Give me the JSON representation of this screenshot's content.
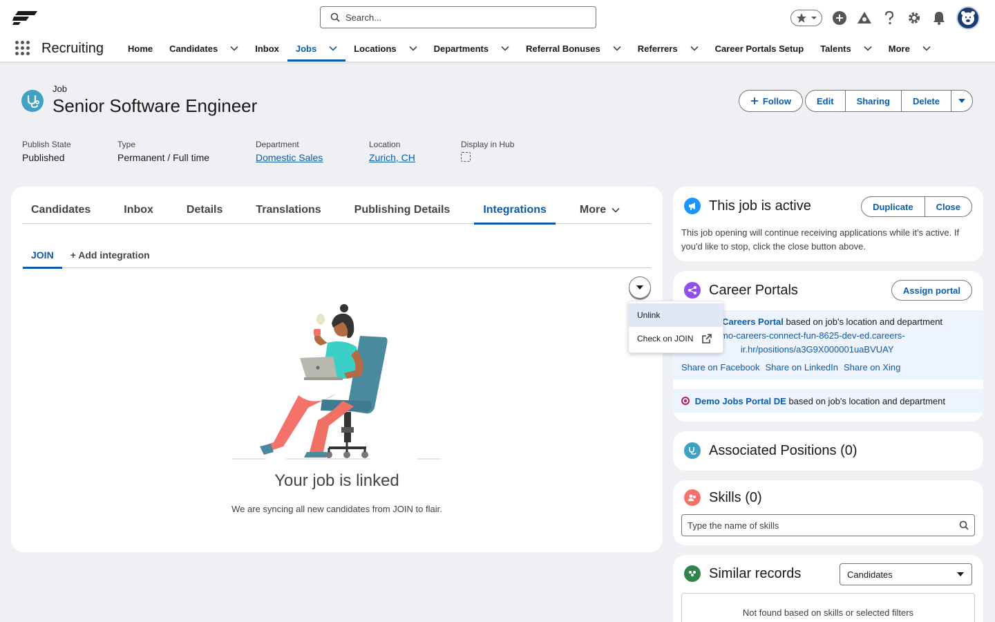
{
  "header": {
    "search_placeholder": "Search...",
    "app_name": "Recruiting"
  },
  "nav": {
    "items": [
      {
        "label": "Home",
        "dropdown": false
      },
      {
        "label": "Candidates",
        "dropdown": true
      },
      {
        "label": "Inbox",
        "dropdown": false
      },
      {
        "label": "Jobs",
        "dropdown": true,
        "active": true
      },
      {
        "label": "Locations",
        "dropdown": true
      },
      {
        "label": "Departments",
        "dropdown": true
      },
      {
        "label": "Referral Bonuses",
        "dropdown": true
      },
      {
        "label": "Referrers",
        "dropdown": true
      },
      {
        "label": "Career Portals Setup",
        "dropdown": false
      },
      {
        "label": "Talents",
        "dropdown": true
      },
      {
        "label": "More",
        "dropdown": true
      }
    ]
  },
  "record": {
    "type": "Job",
    "title": "Senior Software Engineer",
    "actions": {
      "follow": "Follow",
      "edit": "Edit",
      "sharing": "Sharing",
      "delete": "Delete"
    },
    "fields": [
      {
        "label": "Publish State",
        "value": "Published"
      },
      {
        "label": "Type",
        "value": "Permanent / Full time"
      },
      {
        "label": "Department",
        "value": "Domestic Sales"
      },
      {
        "label": "Location",
        "value": "Zurich, CH"
      },
      {
        "label": "Display in Hub",
        "value": ""
      }
    ]
  },
  "main": {
    "tabs": [
      "Candidates",
      "Inbox",
      "Details",
      "Translations",
      "Publishing Details",
      "Integrations",
      "More"
    ],
    "subtabs": [
      "JOIN",
      "+ Add integration"
    ],
    "linked_title": "Your job is linked",
    "linked_sub": "We are syncing all new candidates from JOIN to flair.",
    "menu": {
      "unlink": "Unlink",
      "check": "Check on JOIN"
    }
  },
  "side": {
    "active": {
      "title": "This job is active",
      "duplicate": "Duplicate",
      "close": "Close",
      "text": "This job opening will continue receiving applications while it's active. If you'd like to stop, click the close button above."
    },
    "portals": {
      "title": "Career Portals",
      "assign": "Assign portal",
      "p1_name": "Careers Portal",
      "p1_suffix": "based on job's location and department",
      "p1_url": "mo-careers-connect-fun-8625-dev-ed.careers-        ir.hr/positions/a3G9X000001uaBVUAY",
      "share": [
        "Share on Facebook",
        "Share on LinkedIn",
        "Share on Xing"
      ],
      "p2_name": "Demo Jobs Portal DE",
      "p2_suffix": "based on job's location and department"
    },
    "positions": {
      "title": "Associated Positions (0)"
    },
    "skills": {
      "title": "Skills (0)",
      "placeholder": "Type the name of skills"
    },
    "similar": {
      "title": "Similar records",
      "select": "Candidates",
      "empty": "Not found based on skills or selected filters"
    }
  },
  "colors": {
    "brand": "#0b5cab",
    "job_icon": "#3fa2c2",
    "portal_icon": "#9050e9",
    "skills_icon": "#f4726a",
    "similar_icon": "#2e844a"
  }
}
